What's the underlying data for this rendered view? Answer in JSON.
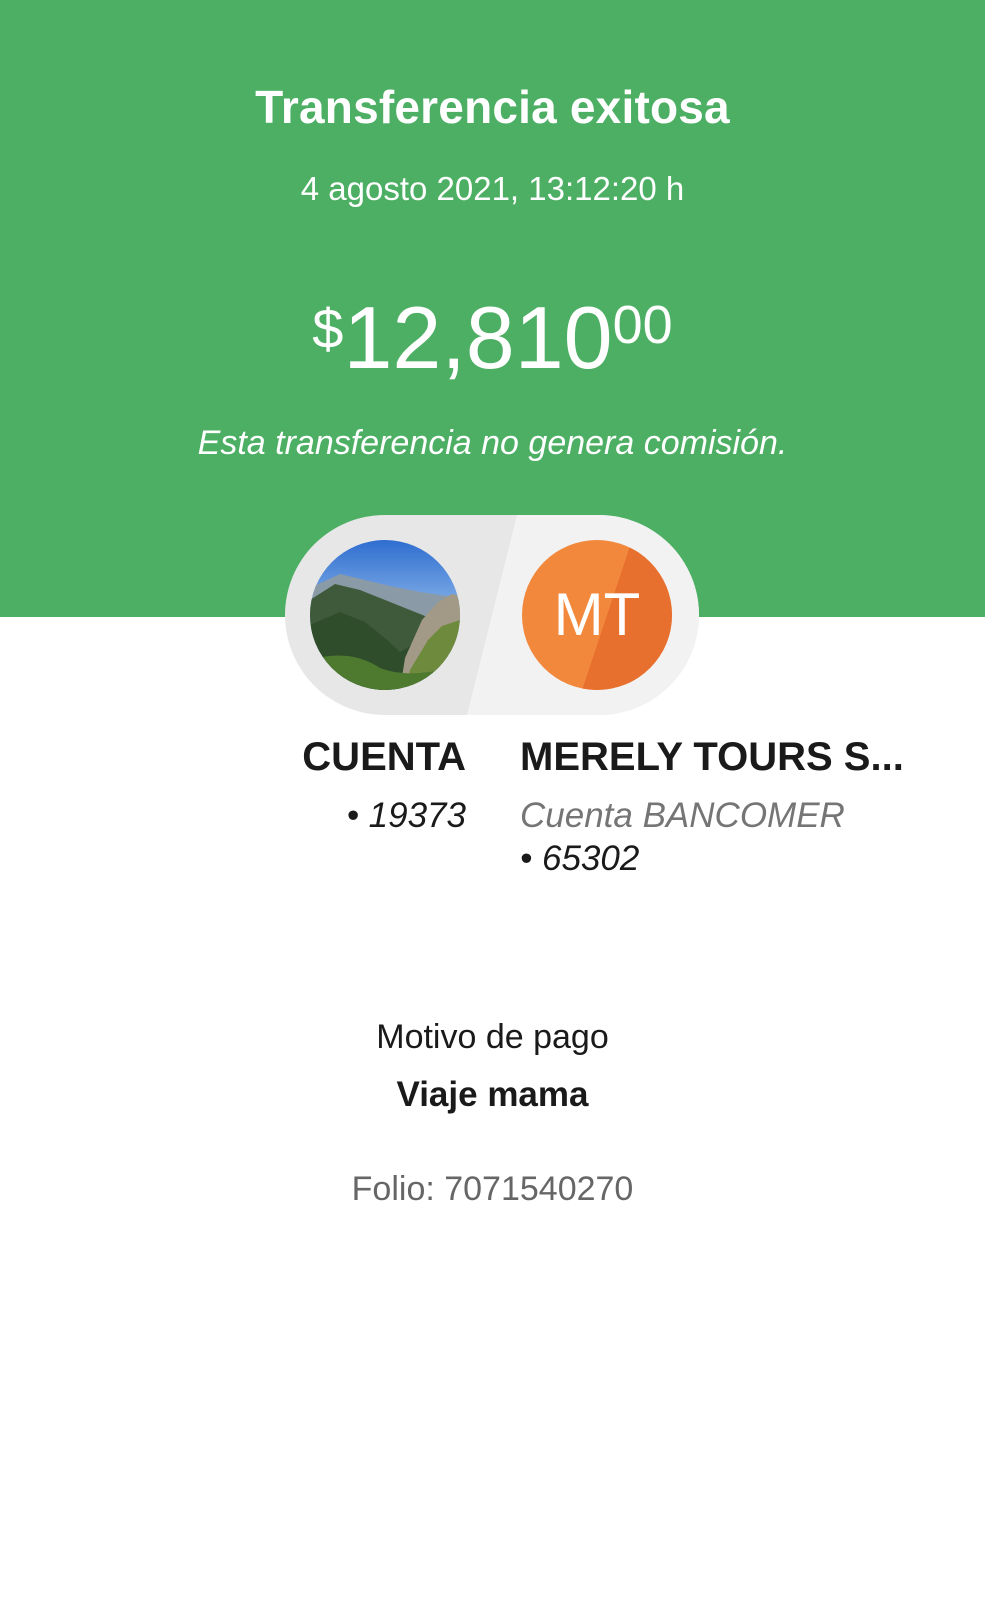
{
  "header": {
    "title": "Transferencia exitosa",
    "datetime": "4 agosto 2021, 13:12:20 h",
    "amount": {
      "currency": "$",
      "integer": "12,810",
      "decimals": "00"
    },
    "note": "Esta transferencia no genera comisión."
  },
  "colors": {
    "success_green": "#4caf63",
    "avatar_orange": "#f2883c"
  },
  "origin": {
    "name": "CUENTA",
    "account": "• 19373"
  },
  "destination": {
    "initials": "MT",
    "name": "MERELY TOURS S...",
    "bank": "Cuenta BANCOMER",
    "account": "• 65302"
  },
  "payment": {
    "reason_label": "Motivo de pago",
    "reason_value": "Viaje mama",
    "folio": "Folio: 7071540270"
  }
}
